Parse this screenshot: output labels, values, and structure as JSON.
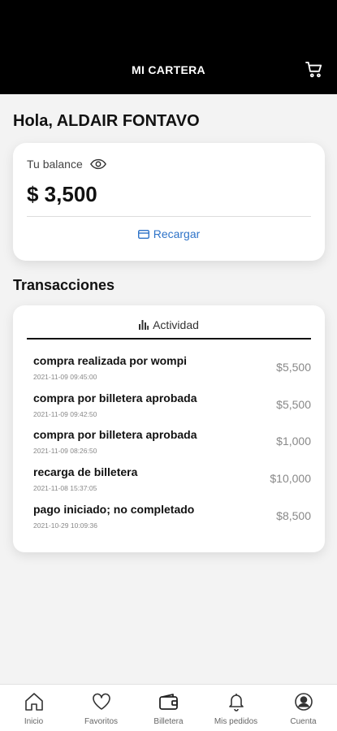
{
  "header": {
    "title": "MI CARTERA",
    "cart_icon": "cart-icon"
  },
  "greeting": "Hola, ALDAIR FONTAVO",
  "balance": {
    "label": "Tu balance",
    "amount": "$ 3,500",
    "recharge_label": "Recargar"
  },
  "transactions": {
    "title": "Transacciones",
    "tab_label": "Actividad",
    "items": [
      {
        "desc": "compra realizada por wompi",
        "date": "2021-11-09 09:45:00",
        "amount": "$5,500"
      },
      {
        "desc": "compra por billetera aprobada",
        "date": "2021-11-09 09:42:50",
        "amount": "$5,500"
      },
      {
        "desc": "compra por billetera aprobada",
        "date": "2021-11-09 08:26:50",
        "amount": "$1,000"
      },
      {
        "desc": "recarga de billetera",
        "date": "2021-11-08 15:37:05",
        "amount": "$10,000"
      },
      {
        "desc": "pago iniciado; no completado",
        "date": "2021-10-29 10:09:36",
        "amount": "$8,500"
      }
    ]
  },
  "nav": {
    "items": [
      {
        "label": "Inicio",
        "icon": "home-icon"
      },
      {
        "label": "Favoritos",
        "icon": "heart-icon"
      },
      {
        "label": "Billetera",
        "icon": "wallet-icon"
      },
      {
        "label": "Mis pedidos",
        "icon": "bell-icon"
      },
      {
        "label": "Cuenta",
        "icon": "account-icon"
      }
    ]
  },
  "colors": {
    "header_bg": "#000000",
    "accent": "#2e73c8",
    "background": "#f3f3f3"
  }
}
